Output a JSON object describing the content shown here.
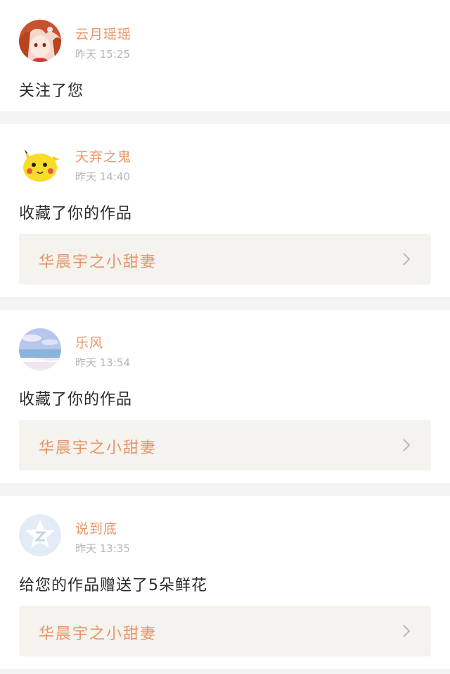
{
  "notifications": [
    {
      "user": "云月瑶瑶",
      "time": "昨天 15:25",
      "action": "关注了您",
      "avatar": "anime-girl-avatar"
    },
    {
      "user": "天弃之鬼",
      "time": "昨天 14:40",
      "action": "收藏了你的作品",
      "work": "华晨宇之小甜妻",
      "avatar": "pikachu-avatar"
    },
    {
      "user": "乐风",
      "time": "昨天 13:54",
      "action": "收藏了你的作品",
      "work": "华晨宇之小甜妻",
      "avatar": "sea-sky-avatar"
    },
    {
      "user": "说到底",
      "time": "昨天 13:35",
      "action": "给您的作品赠送了5朵鲜花",
      "work": "华晨宇之小甜妻",
      "avatar": "default-star-avatar"
    }
  ],
  "colors": {
    "accent": "#e8956a",
    "background": "#f4f4f4",
    "card": "#ffffff",
    "work_box": "#f4f3ed",
    "time": "#b5b5b5"
  }
}
